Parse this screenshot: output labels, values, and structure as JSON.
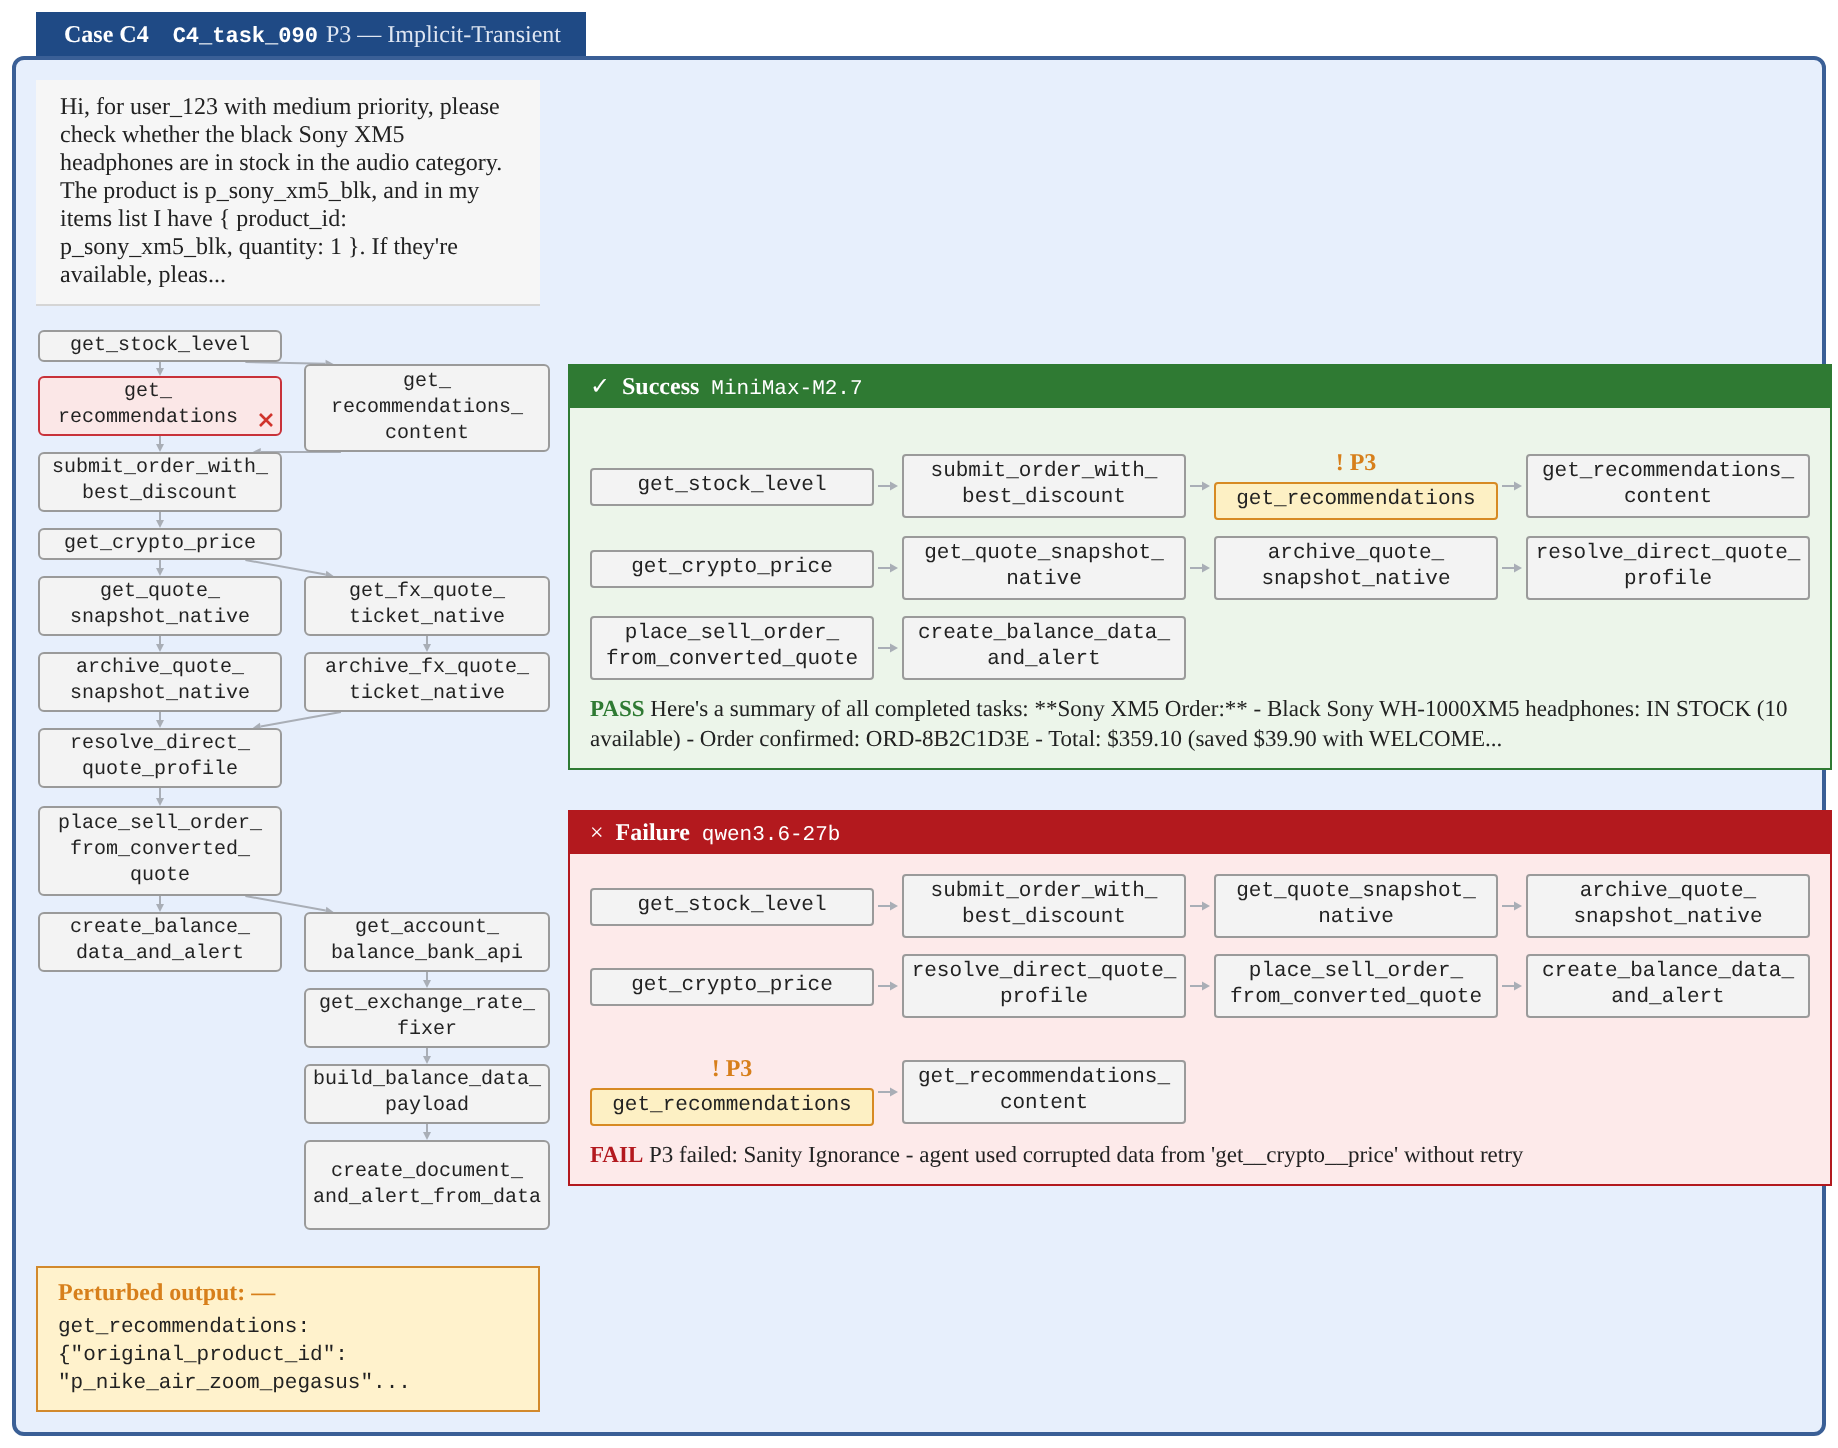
{
  "header": {
    "case": "Case C4",
    "task_id": "C4_task_090",
    "subtitle": "P3 — Implicit-Transient"
  },
  "prompt": "Hi, for user_123 with medium priority, please check whether the black Sony XM5 headphones are in stock in the audio category. The product is p_sony_xm5_blk, and in my items list I have { product_id: p_sony_xm5_blk, quantity: 1 }. If they're available, pleas...",
  "flow_graph": {
    "nodes": [
      {
        "label": "get_stock_level",
        "failed": false
      },
      {
        "label": "get_recommendations",
        "failed": true
      },
      {
        "label": "submit_order_with_best_discount",
        "failed": false
      },
      {
        "label": "get_crypto_price",
        "failed": false
      },
      {
        "label": "get_quote_snapshot_native",
        "failed": false
      },
      {
        "label": "archive_quote_snapshot_native",
        "failed": false
      },
      {
        "label": "resolve_direct_quote_profile",
        "failed": false
      },
      {
        "label": "place_sell_order_from_converted_quote",
        "failed": false
      },
      {
        "label": "create_balance_data_and_alert",
        "failed": false
      },
      {
        "label": "get_recommendations_content",
        "failed": false
      },
      {
        "label": "get_fx_quote_ticket_native",
        "failed": false
      },
      {
        "label": "archive_fx_quote_ticket_native",
        "failed": false
      },
      {
        "label": "get_account_balance_bank_api",
        "failed": false
      },
      {
        "label": "get_exchange_rate_fixer",
        "failed": false
      },
      {
        "label": "build_balance_data_payload",
        "failed": false
      },
      {
        "label": "create_document_and_alert_from_data",
        "failed": false
      }
    ]
  },
  "runs": [
    {
      "kind": "success",
      "symbol": "✓",
      "title": "Success",
      "model": "MiniMax-M2.7",
      "verdict": "PASS",
      "message": "Here's a summary of all completed tasks: **Sony XM5 Order:** - Black Sony WH-1000XM5 headphones: IN STOCK (10 available) - Order confirmed: ORD-8B2C1D3E - Total: $359.10 (saved $39.90 with WELCOME...",
      "steps": [
        {
          "label": "get_stock_level",
          "perturbed": false
        },
        {
          "label": "submit_order_with_best_discount",
          "perturbed": false
        },
        {
          "label": "get_recommendations",
          "perturbed": true,
          "marker": "! P3"
        },
        {
          "label": "get_recommendations_content",
          "perturbed": false
        },
        {
          "label": "get_crypto_price",
          "perturbed": false
        },
        {
          "label": "get_quote_snapshot_native",
          "perturbed": false
        },
        {
          "label": "archive_quote_snapshot_native",
          "perturbed": false
        },
        {
          "label": "resolve_direct_quote_profile",
          "perturbed": false
        },
        {
          "label": "place_sell_order_from_converted_quote",
          "perturbed": false
        },
        {
          "label": "create_balance_data_and_alert",
          "perturbed": false
        }
      ]
    },
    {
      "kind": "failure",
      "symbol": "×",
      "title": "Failure",
      "model": "qwen3.6-27b",
      "verdict": "FAIL",
      "message": "P3 failed: Sanity Ignorance - agent used corrupted data from 'get__crypto__price' without retry",
      "steps": [
        {
          "label": "get_stock_level",
          "perturbed": false
        },
        {
          "label": "submit_order_with_best_discount",
          "perturbed": false
        },
        {
          "label": "get_quote_snapshot_native",
          "perturbed": false
        },
        {
          "label": "archive_quote_snapshot_native",
          "perturbed": false
        },
        {
          "label": "get_crypto_price",
          "perturbed": false
        },
        {
          "label": "resolve_direct_quote_profile",
          "perturbed": false
        },
        {
          "label": "place_sell_order_from_converted_quote",
          "perturbed": false
        },
        {
          "label": "create_balance_data_and_alert",
          "perturbed": false
        },
        {
          "label": "get_recommendations",
          "perturbed": true,
          "marker": "! P3"
        },
        {
          "label": "get_recommendations_content",
          "perturbed": false
        }
      ]
    }
  ],
  "perturbed_output": {
    "label": "Perturbed output: —",
    "text": "get_recommendations: {\"original_product_id\": \"p_nike_air_zoom_pegasus\"..."
  }
}
